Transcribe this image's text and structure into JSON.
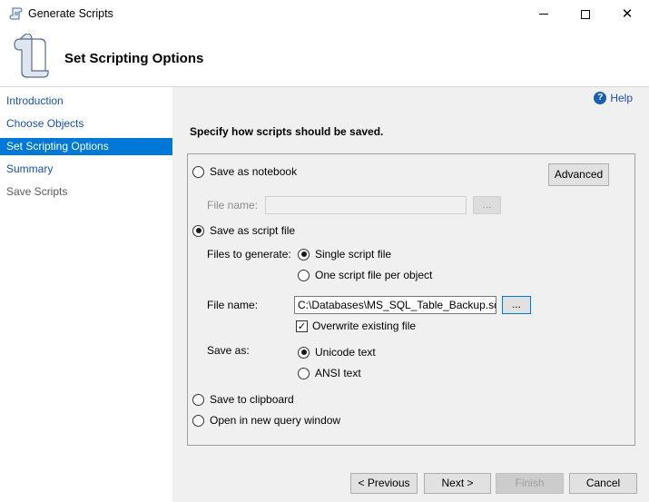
{
  "window": {
    "title": "Generate Scripts",
    "page_title": "Set Scripting Options"
  },
  "sidebar": {
    "items": [
      {
        "label": "Introduction",
        "state": "link"
      },
      {
        "label": "Choose Objects",
        "state": "link"
      },
      {
        "label": "Set Scripting Options",
        "state": "active"
      },
      {
        "label": "Summary",
        "state": "link"
      },
      {
        "label": "Save Scripts",
        "state": "disabled"
      }
    ]
  },
  "content": {
    "help_label": "Help",
    "instruction": "Specify how scripts should be saved.",
    "notebook": {
      "label": "Save as notebook",
      "file_name_label": "File name:",
      "file_name_value": "",
      "browse_label": "...",
      "checked": false
    },
    "advanced_label": "Advanced",
    "script_file": {
      "label": "Save as script file",
      "checked": true,
      "files_to_generate_label": "Files to generate:",
      "single_label": "Single script file",
      "single_checked": true,
      "per_object_label": "One script file per object",
      "per_object_checked": false,
      "file_name_label": "File name:",
      "file_name_value": "C:\\Databases\\MS_SQL_Table_Backup.sql",
      "browse_label": "...",
      "overwrite_label": "Overwrite existing file",
      "overwrite_checked": true,
      "save_as_label": "Save as:",
      "unicode_label": "Unicode text",
      "unicode_checked": true,
      "ansi_label": "ANSI text",
      "ansi_checked": false
    },
    "clipboard_label": "Save to clipboard",
    "query_window_label": "Open in new query window"
  },
  "footer": {
    "previous_label": "< Previous",
    "next_label": "Next >",
    "finish_label": "Finish",
    "cancel_label": "Cancel"
  }
}
